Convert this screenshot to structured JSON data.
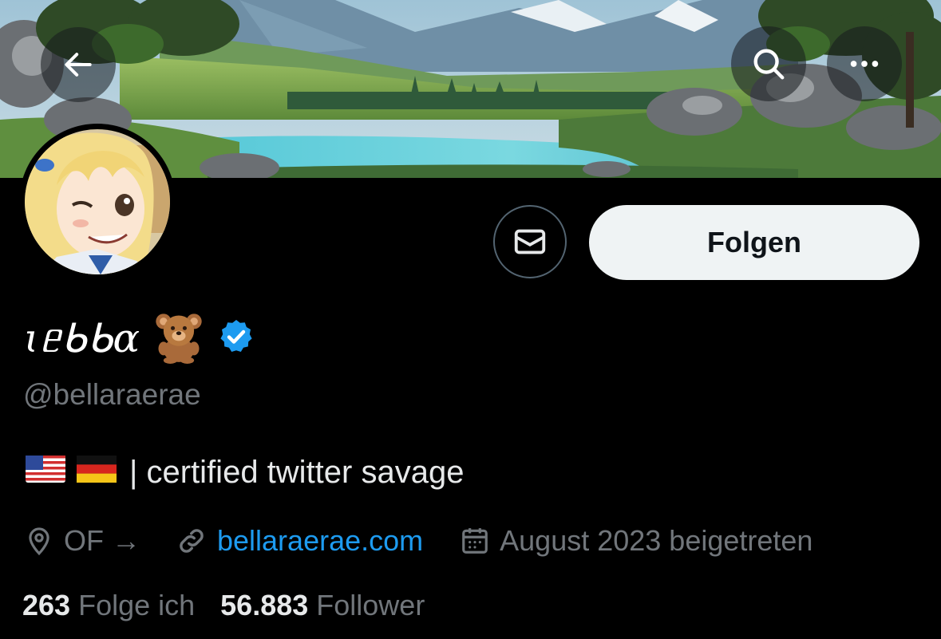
{
  "header": {
    "back_icon": "arrow-left-icon",
    "search_icon": "search-icon",
    "more_icon": "more-horizontal-icon"
  },
  "actions": {
    "message_icon": "mail-icon",
    "follow_label": "Folgen"
  },
  "profile": {
    "display_name": "ɩᥱᑲᑲɑ",
    "name_emoji": "teddy-bear-icon",
    "verified": true,
    "handle": "@bellaraerae",
    "bio_flags": [
      "us-flag-icon",
      "germany-flag-icon"
    ],
    "bio_text": "| certified twitter savage",
    "location": "OF →",
    "website": "bellaraerae.com",
    "joined": "August 2023 beigetreten"
  },
  "stats": {
    "following_count": "263",
    "following_label": "Folge ich",
    "followers_count": "56.883",
    "followers_label": "Follower"
  },
  "colors": {
    "background": "#000000",
    "link": "#1d9bf0",
    "verified": "#1d9bf0",
    "muted_text": "#71767b",
    "follow_button": "#eff3f4"
  }
}
